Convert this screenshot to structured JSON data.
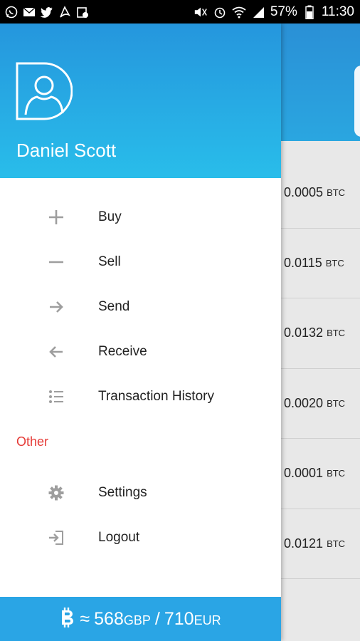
{
  "status_bar": {
    "battery": "57%",
    "time": "11:30"
  },
  "drawer": {
    "user_name": "Daniel Scott",
    "menu": [
      {
        "label": "Buy",
        "icon": "plus-icon"
      },
      {
        "label": "Sell",
        "icon": "minus-icon"
      },
      {
        "label": "Send",
        "icon": "arrow-right-icon"
      },
      {
        "label": "Receive",
        "icon": "arrow-left-icon"
      },
      {
        "label": "Transaction History",
        "icon": "list-icon"
      }
    ],
    "other_label": "Other",
    "other_menu": [
      {
        "label": "Settings",
        "icon": "gear-icon"
      },
      {
        "label": "Logout",
        "icon": "logout-icon"
      }
    ],
    "footer": {
      "approx": "≈",
      "gbp_value": "568",
      "gbp_unit": "GBP",
      "separator": "/",
      "eur_value": "710",
      "eur_unit": "EUR"
    }
  },
  "background_list": [
    {
      "amount": "0.0005",
      "unit": "BTC"
    },
    {
      "amount": "0.0115",
      "unit": "BTC"
    },
    {
      "amount": "0.0132",
      "unit": "BTC"
    },
    {
      "amount": "0.0020",
      "unit": "BTC"
    },
    {
      "amount": "0.0001",
      "unit": "BTC"
    },
    {
      "amount": "0.0121",
      "unit": "BTC"
    }
  ],
  "colors": {
    "header_blue": "#2596dd",
    "footer_blue": "#2aa5e5",
    "accent_red": "#e53935"
  }
}
